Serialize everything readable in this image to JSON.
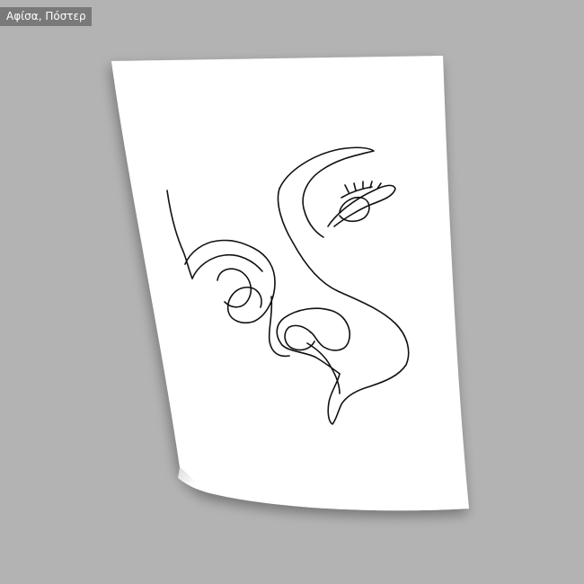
{
  "label": {
    "text": "Αφίσα, Πόστερ"
  },
  "colors": {
    "background": "#b3b3b3",
    "paper": "#ffffff",
    "ink": "#111111"
  },
  "artwork": {
    "style": "single continuous line face drawing"
  }
}
